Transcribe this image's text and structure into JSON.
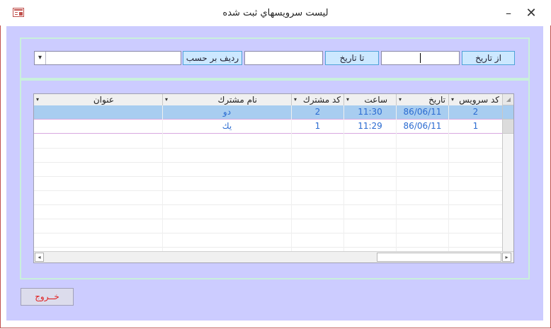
{
  "window": {
    "title": "ليست سرويسهاي ثبت شده",
    "minimize_label": "–",
    "close_label": "✕",
    "icon": "form-icon"
  },
  "filter": {
    "from_date_label": "از تاريخ",
    "from_date_value": "",
    "to_date_label": "تا تاريخ",
    "to_date_value": "",
    "sort_label": "رديف بر حسب",
    "sort_value": "",
    "combo_arrow": "▾"
  },
  "grid": {
    "columns": [
      "كد سرويس",
      "تاريخ",
      "ساعت",
      "كد مشترك",
      "نام مشترك",
      "عنوان"
    ],
    "dropdown_glyph": "▾",
    "rows": [
      {
        "service_code": "2",
        "date": "86/06/11",
        "time": "11:30",
        "customer_code": "2",
        "customer_name": "دو",
        "subject": ""
      },
      {
        "service_code": "1",
        "date": "86/06/11",
        "time": "11:29",
        "customer_code": "1",
        "customer_name": "يك",
        "subject": ""
      }
    ],
    "scroll_left": "◂",
    "scroll_right": "▸"
  },
  "exit_button": "خــروج",
  "colors": {
    "form_bg": "#ccccff",
    "selected_row": "#a8cdf0",
    "cell_text": "#2a6bd1",
    "exit_text": "#e02020"
  }
}
